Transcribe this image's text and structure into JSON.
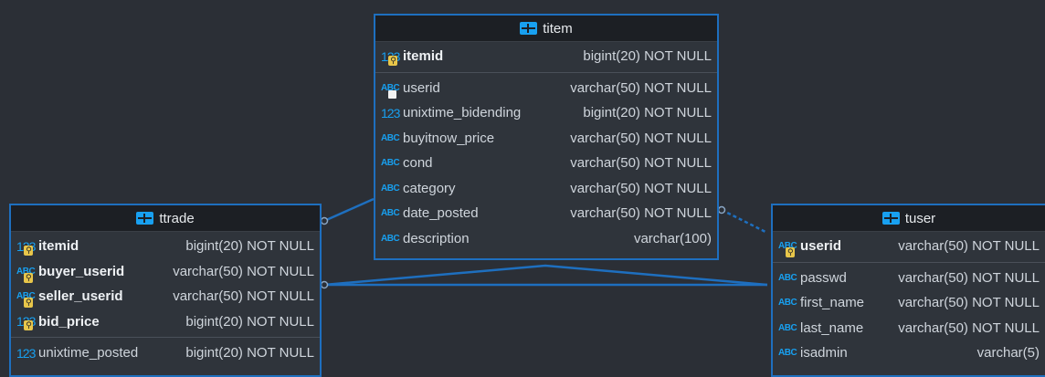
{
  "colors": {
    "background": "#2b2f36",
    "table_border": "#1e6fbf",
    "header_bg": "#1c1f24",
    "icon_accent": "#18a0f0",
    "connector": "#1e6fbf"
  },
  "tables": {
    "titem": {
      "title": "titem",
      "pk": [
        {
          "icon": "123",
          "key": true,
          "fk": false,
          "name": "itemid",
          "type": "bigint(20) NOT NULL"
        }
      ],
      "cols": [
        {
          "icon": "ABC",
          "key": false,
          "fk": true,
          "name": "userid",
          "type": "varchar(50) NOT NULL"
        },
        {
          "icon": "123",
          "key": false,
          "fk": false,
          "name": "unixtime_bidending",
          "type": "bigint(20) NOT NULL"
        },
        {
          "icon": "ABC",
          "key": false,
          "fk": false,
          "name": "buyitnow_price",
          "type": "varchar(50) NOT NULL"
        },
        {
          "icon": "ABC",
          "key": false,
          "fk": false,
          "name": "cond",
          "type": "varchar(50) NOT NULL"
        },
        {
          "icon": "ABC",
          "key": false,
          "fk": false,
          "name": "category",
          "type": "varchar(50) NOT NULL"
        },
        {
          "icon": "ABC",
          "key": false,
          "fk": false,
          "name": "date_posted",
          "type": "varchar(50) NOT NULL"
        },
        {
          "icon": "ABC",
          "key": false,
          "fk": false,
          "name": "description",
          "type": "varchar(100)"
        }
      ]
    },
    "ttrade": {
      "title": "ttrade",
      "pk": [
        {
          "icon": "123",
          "key": true,
          "fk": false,
          "name": "itemid",
          "type": "bigint(20) NOT NULL"
        },
        {
          "icon": "ABC",
          "key": true,
          "fk": false,
          "name": "buyer_userid",
          "type": "varchar(50) NOT NULL"
        },
        {
          "icon": "ABC",
          "key": true,
          "fk": false,
          "name": "seller_userid",
          "type": "varchar(50) NOT NULL"
        },
        {
          "icon": "123",
          "key": true,
          "fk": false,
          "name": "bid_price",
          "type": "bigint(20) NOT NULL"
        }
      ],
      "cols": [
        {
          "icon": "123",
          "key": false,
          "fk": false,
          "name": "unixtime_posted",
          "type": "bigint(20) NOT NULL"
        }
      ]
    },
    "tuser": {
      "title": "tuser",
      "pk": [
        {
          "icon": "ABC",
          "key": true,
          "fk": false,
          "name": "userid",
          "type": "varchar(50) NOT NULL"
        }
      ],
      "cols": [
        {
          "icon": "ABC",
          "key": false,
          "fk": false,
          "name": "passwd",
          "type": "varchar(50) NOT NULL"
        },
        {
          "icon": "ABC",
          "key": false,
          "fk": false,
          "name": "first_name",
          "type": "varchar(50) NOT NULL"
        },
        {
          "icon": "ABC",
          "key": false,
          "fk": false,
          "name": "last_name",
          "type": "varchar(50) NOT NULL"
        },
        {
          "icon": "ABC",
          "key": false,
          "fk": false,
          "name": "isadmin",
          "type": "varchar(5)"
        }
      ]
    }
  }
}
